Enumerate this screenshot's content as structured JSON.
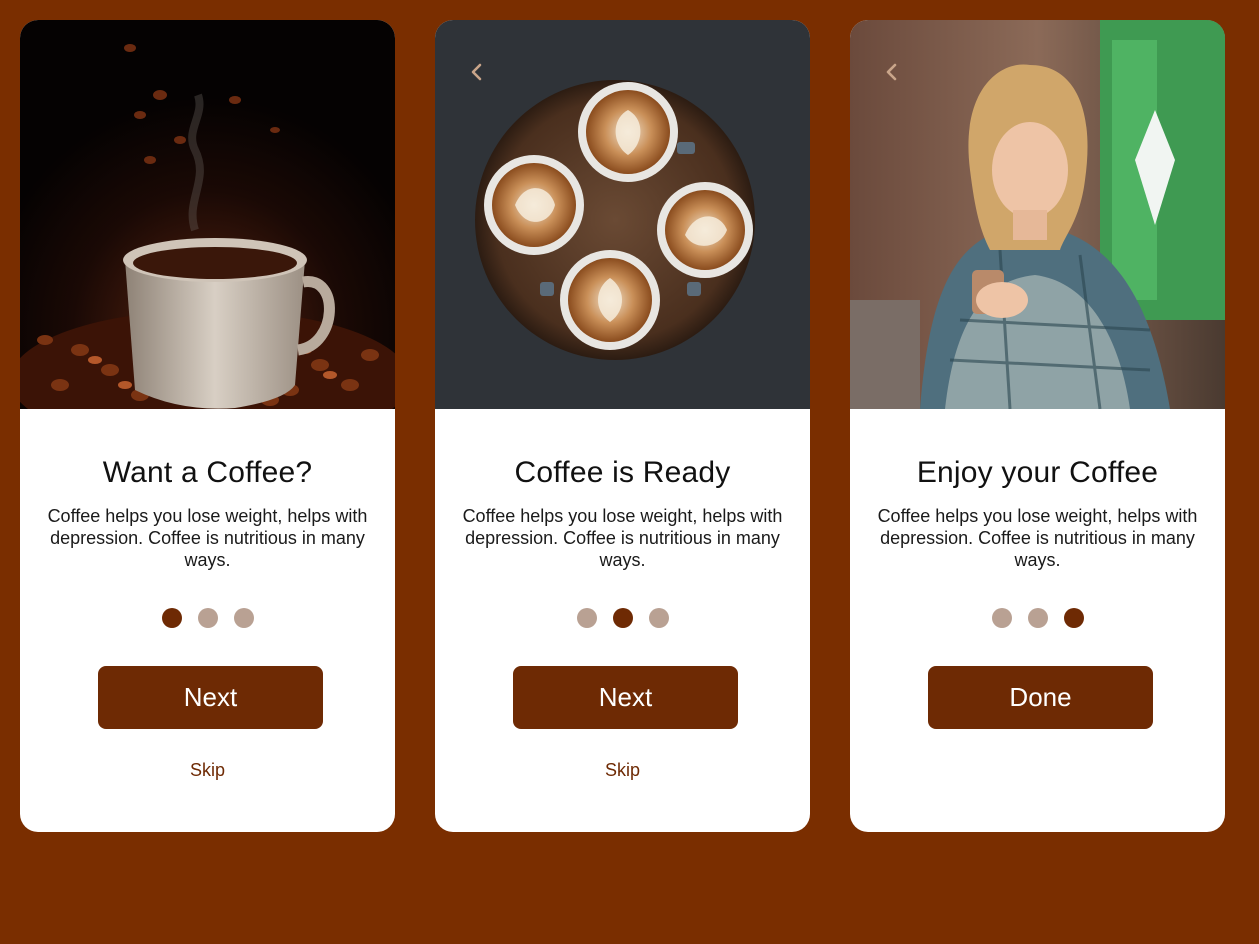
{
  "colors": {
    "background": "#7a2e00",
    "primary": "#6e2a04",
    "dot_inactive": "#b9a193",
    "card": "#ffffff"
  },
  "screens": [
    {
      "image": "coffee-cup-with-beans-photo",
      "has_back": false,
      "title": "Want a Coffee?",
      "description": "Coffee helps you lose weight, helps with depression. Coffee is nutritious in many ways.",
      "active_dot": 1,
      "button_label": "Next",
      "skip_label": "Skip"
    },
    {
      "image": "latte-art-cups-photo",
      "has_back": true,
      "title": "Coffee is Ready",
      "description": "Coffee helps you lose weight, helps with depression. Coffee is nutritious in many ways.",
      "active_dot": 2,
      "button_label": "Next",
      "skip_label": "Skip"
    },
    {
      "image": "woman-drinking-coffee-photo",
      "has_back": true,
      "title": "Enjoy your Coffee",
      "description": "Coffee helps you lose weight, helps with depression. Coffee is nutritious in many ways.",
      "active_dot": 3,
      "button_label": "Done"
    }
  ]
}
